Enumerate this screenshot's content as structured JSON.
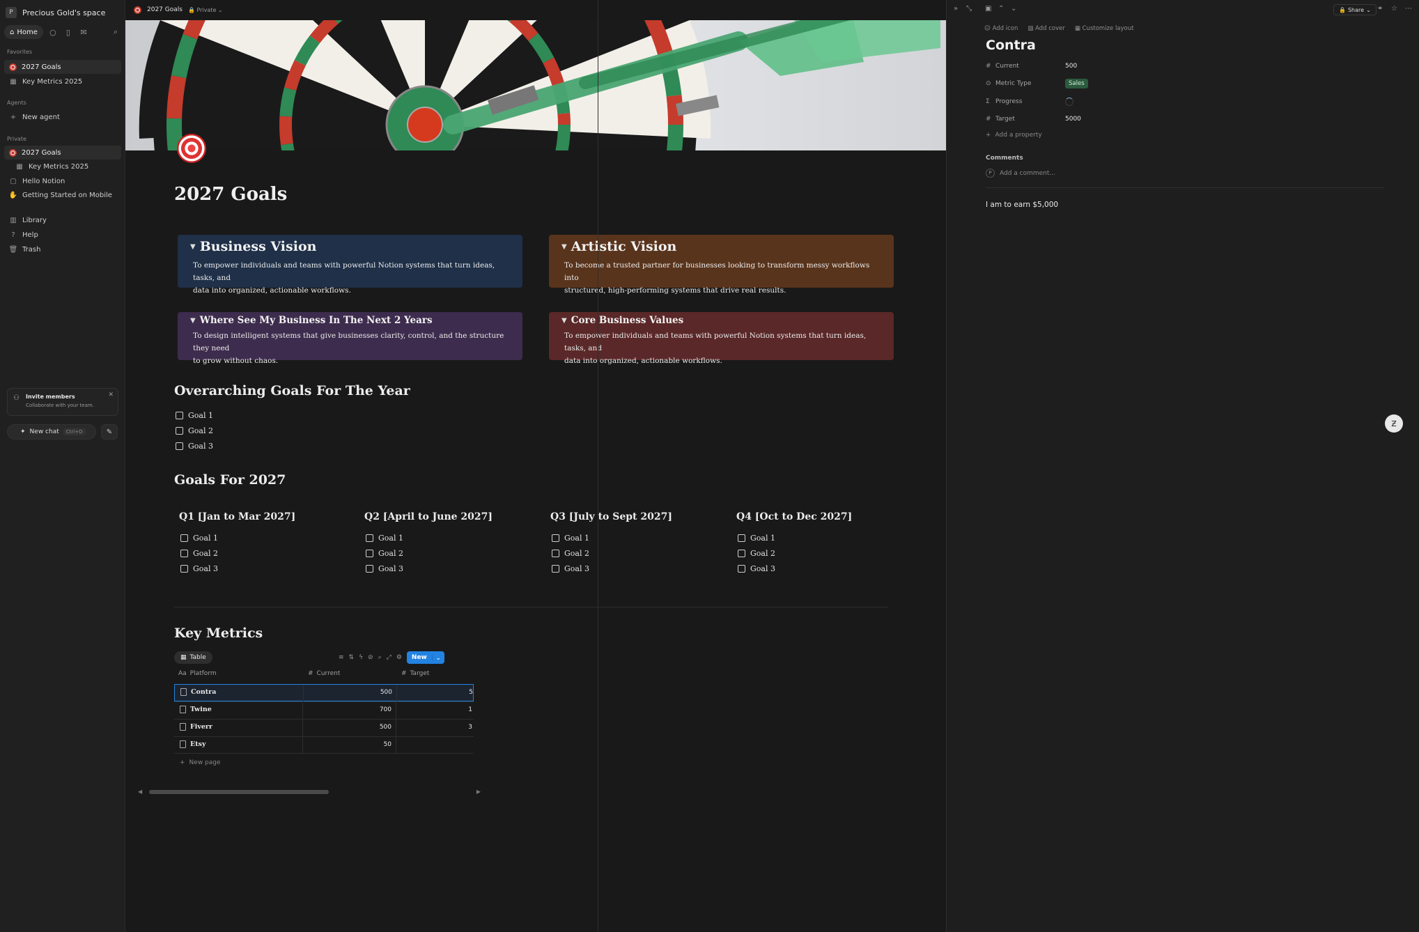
{
  "sidebar": {
    "workspace_initial": "P",
    "workspace_name": "Precious Gold's space",
    "home_label": "Home",
    "favorites_label": "Favorites",
    "favorites": [
      {
        "label": "2027 Goals",
        "icon": "dart-icon"
      },
      {
        "label": "Key Metrics 2025",
        "icon": "table-icon"
      }
    ],
    "agents_label": "Agents",
    "new_agent_label": "New agent",
    "private_label": "Private",
    "private_items": [
      {
        "label": "2027 Goals",
        "icon": "dart-icon"
      },
      {
        "label": "Key Metrics 2025",
        "icon": "table-icon"
      },
      {
        "label": "Hello Notion",
        "icon": "page-icon"
      },
      {
        "label": "Getting Started on Mobile",
        "icon": "wave-icon"
      }
    ],
    "library_label": "Library",
    "help_label": "Help",
    "trash_label": "Trash",
    "invite_title": "Invite members",
    "invite_sub": "Collaborate with your team.",
    "new_chat_label": "New chat",
    "new_chat_shortcut": "Ctrl+O"
  },
  "main": {
    "breadcrumb_title": "2027 Goals",
    "privacy_label": "Private",
    "page_title": "2027 Goals",
    "callouts": [
      {
        "title": "Business Vision",
        "text_l1": "To empower individuals and teams with powerful Notion systems that turn ideas, tasks, and",
        "text_l2": "data into organized, actionable workflows.",
        "bg": "#1f3048"
      },
      {
        "title": "Artistic Vision",
        "text_l1": "To become a trusted partner for businesses looking to transform messy workflows into",
        "text_l2": "structured, high-performing systems that drive real results.",
        "bg": "#59341c"
      },
      {
        "title": "Where See My Business In The Next 2 Years",
        "text_l1": "To design intelligent systems that give businesses clarity, control, and the structure they need",
        "text_l2": "to grow without chaos.",
        "bg": "#3d2c4d"
      },
      {
        "title": "Core Business Values",
        "text_l1": "To empower individuals and teams with powerful Notion systems that turn ideas, tasks, and",
        "text_l2": "data into organized, actionable workflows.",
        "bg": "#5a2828"
      }
    ],
    "overarching_heading": "Overarching Goals For The Year",
    "overarching_goals": [
      "Goal 1",
      "Goal 2",
      "Goal 3"
    ],
    "goals_heading": "Goals For 2027",
    "quarters": [
      {
        "title": "Q1 [Jan to Mar 2027]",
        "goals": [
          "Goal 1",
          "Goal 2",
          "Goal 3"
        ]
      },
      {
        "title": "Q2 [April to June 2027]",
        "goals": [
          "Goal 1",
          "Goal 2",
          "Goal 3"
        ]
      },
      {
        "title": "Q3 [July to Sept 2027]",
        "goals": [
          "Goal 1",
          "Goal 2",
          "Goal 3"
        ]
      },
      {
        "title": "Q4 [Oct to Dec 2027]",
        "goals": [
          "Goal 1",
          "Goal 2",
          "Goal 3"
        ]
      }
    ],
    "key_metrics_heading": "Key Metrics",
    "table_view_label": "Table",
    "new_button_label": "New",
    "columns": {
      "platform": "Platform",
      "current": "Current",
      "target": "Target"
    },
    "rows": [
      {
        "platform": "Contra",
        "current": "500",
        "target": "5"
      },
      {
        "platform": "Twine",
        "current": "700",
        "target": "1"
      },
      {
        "platform": "Fiverr",
        "current": "500",
        "target": "3"
      },
      {
        "platform": "Etsy",
        "current": "50",
        "target": ""
      }
    ],
    "new_page_label": "New page"
  },
  "panel": {
    "share_label": "Share",
    "add_icon_label": "Add icon",
    "add_cover_label": "Add cover",
    "customize_label": "Customize layout",
    "title": "Contra",
    "props": {
      "current_label": "Current",
      "current_value": "500",
      "metric_type_label": "Metric Type",
      "metric_type_value": "Sales",
      "progress_label": "Progress",
      "target_label": "Target",
      "target_value": "5000"
    },
    "add_property_label": "Add a property",
    "comments_label": "Comments",
    "comment_avatar": "P",
    "comment_placeholder": "Add a comment...",
    "body_text": "I am to earn $5,000"
  },
  "colors": {
    "accent": "#2383e2",
    "sales_tag": "#2b5a3d",
    "background": "#191919"
  }
}
